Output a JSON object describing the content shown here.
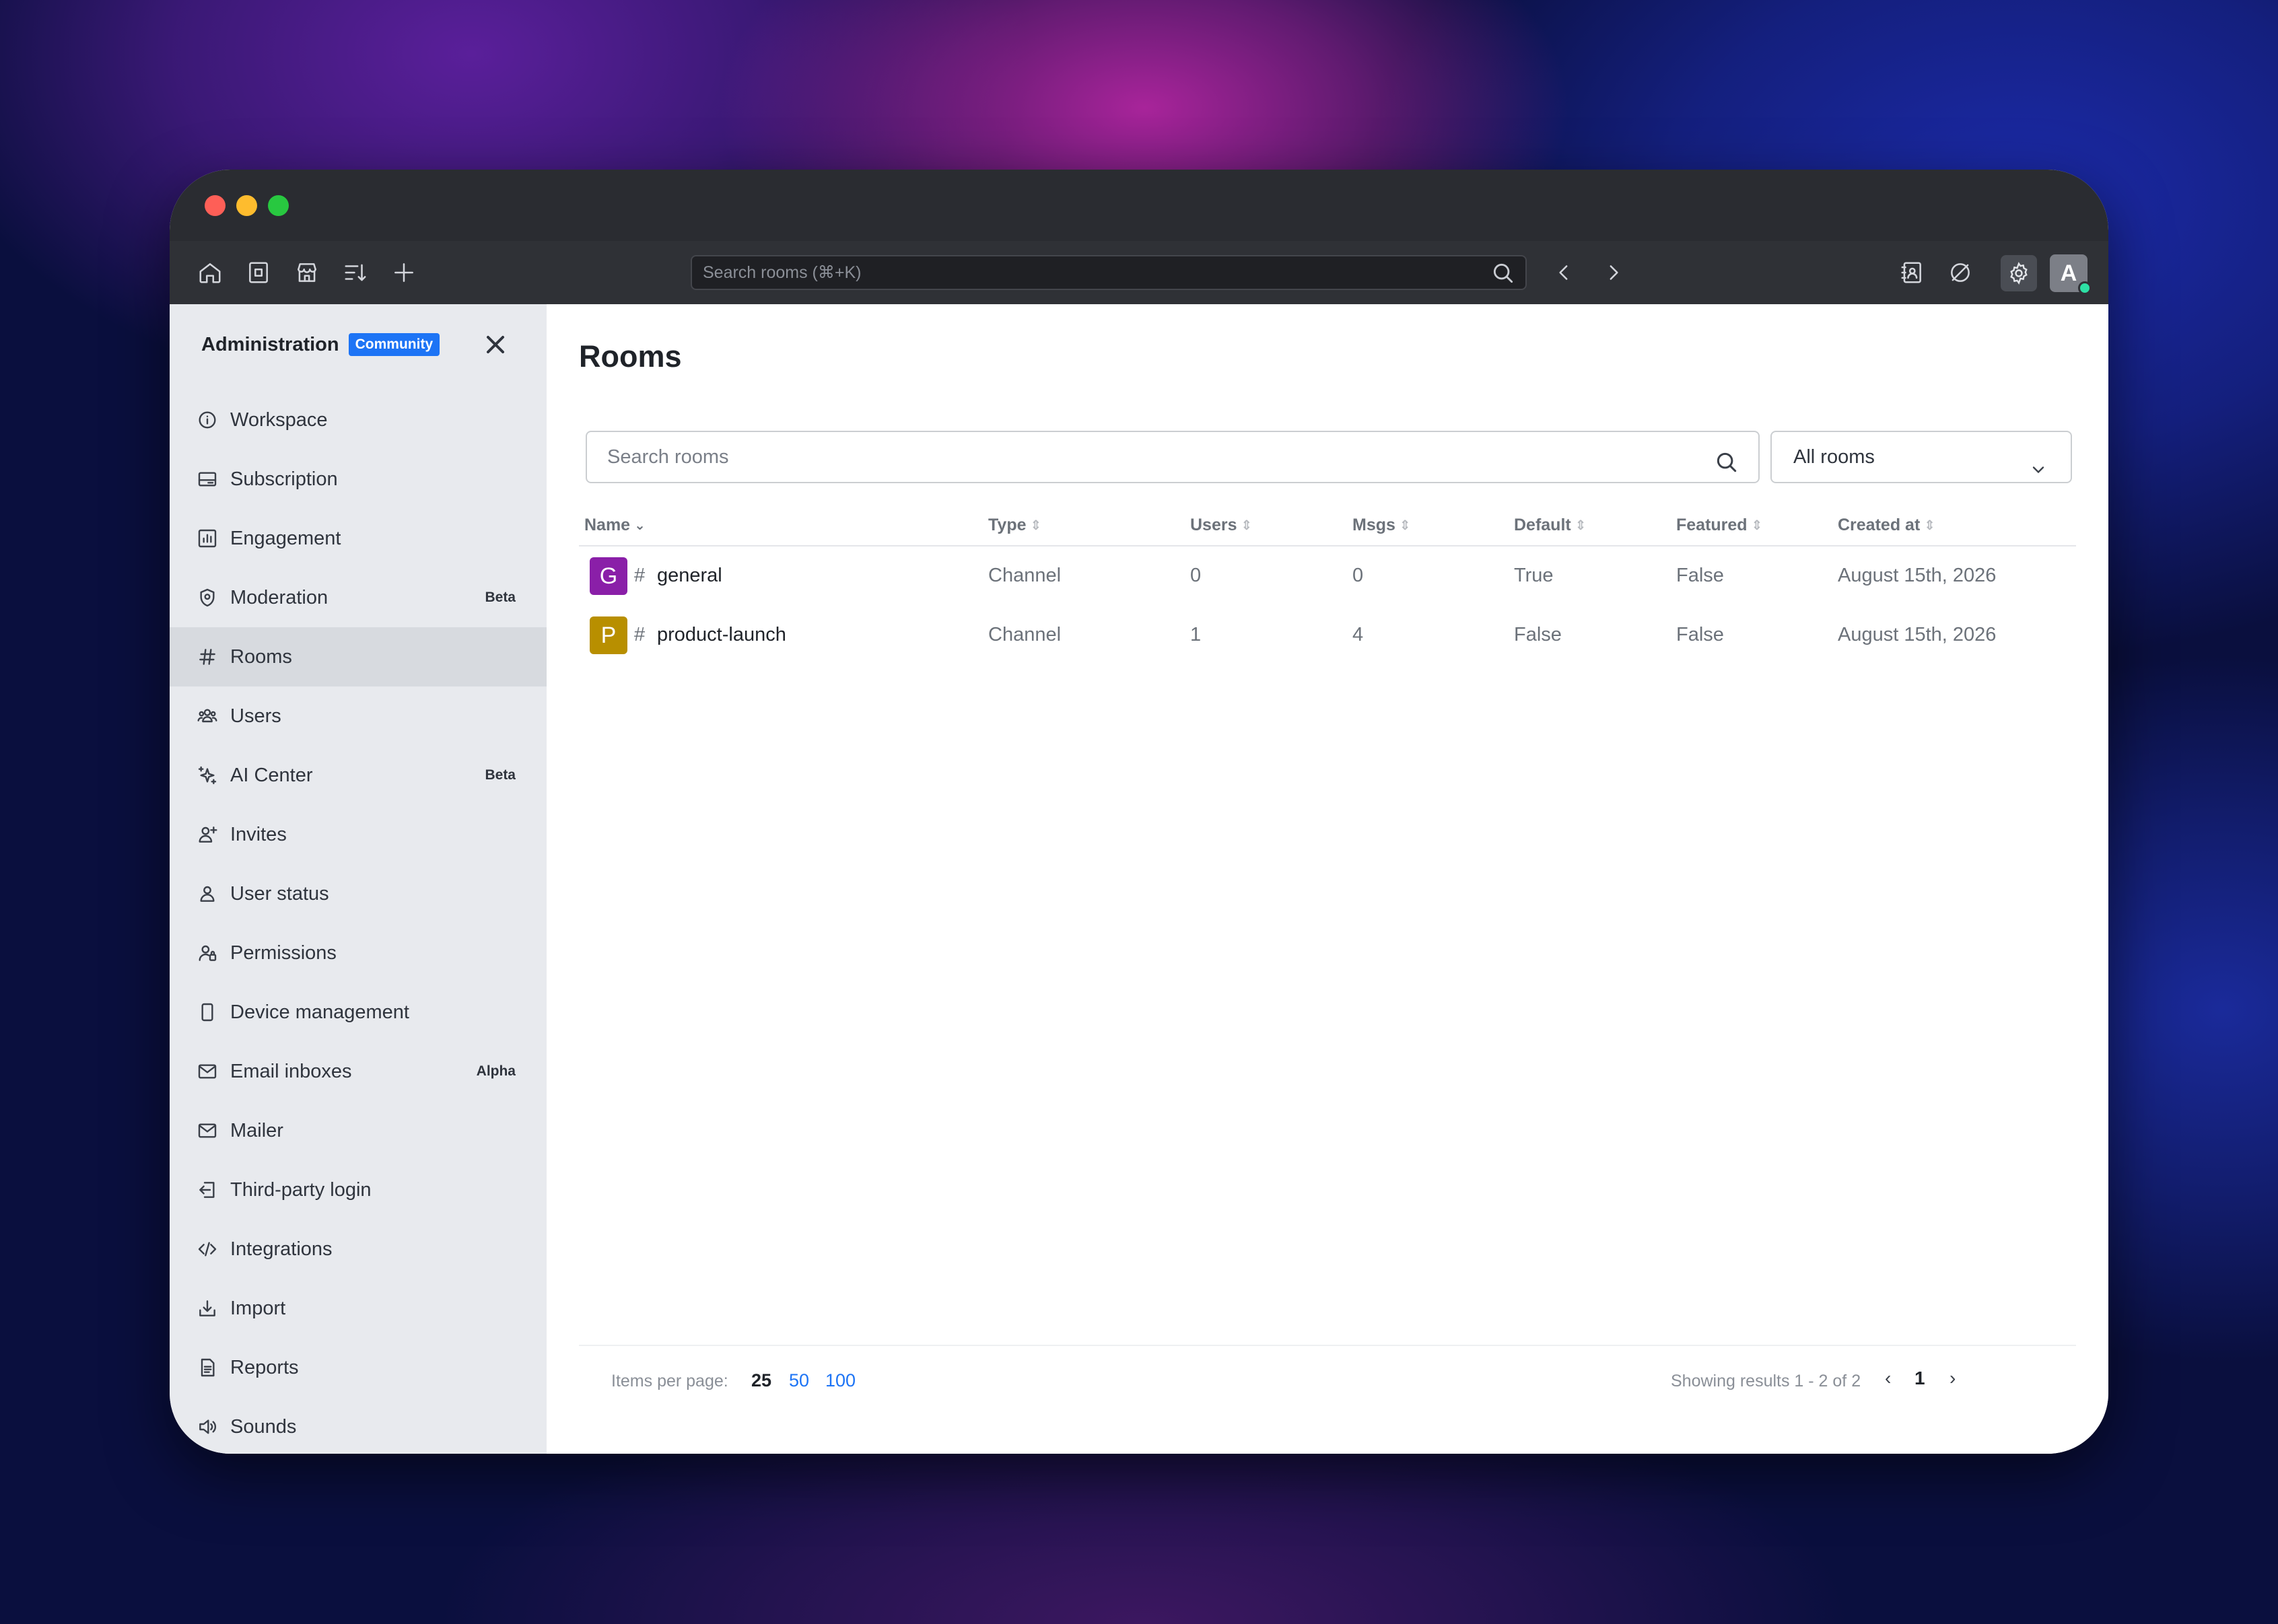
{
  "toolbar": {
    "search_placeholder": "Search rooms (⌘+K)",
    "avatar_initial": "A"
  },
  "sidebar": {
    "title": "Administration",
    "badge": "Community",
    "items": [
      {
        "label": "Workspace",
        "icon": "info-icon",
        "tag": ""
      },
      {
        "label": "Subscription",
        "icon": "card-icon",
        "tag": ""
      },
      {
        "label": "Engagement",
        "icon": "chart-icon",
        "tag": ""
      },
      {
        "label": "Moderation",
        "icon": "shield-icon",
        "tag": "Beta"
      },
      {
        "label": "Rooms",
        "icon": "hash-icon",
        "tag": "",
        "active": true
      },
      {
        "label": "Users",
        "icon": "team-icon",
        "tag": ""
      },
      {
        "label": "AI Center",
        "icon": "sparkles-icon",
        "tag": "Beta"
      },
      {
        "label": "Invites",
        "icon": "user-plus-icon",
        "tag": ""
      },
      {
        "label": "User status",
        "icon": "user-icon",
        "tag": ""
      },
      {
        "label": "Permissions",
        "icon": "user-lock-icon",
        "tag": ""
      },
      {
        "label": "Device management",
        "icon": "phone-icon",
        "tag": ""
      },
      {
        "label": "Email inboxes",
        "icon": "mail-icon",
        "tag": "Alpha"
      },
      {
        "label": "Mailer",
        "icon": "mail-icon",
        "tag": ""
      },
      {
        "label": "Third-party login",
        "icon": "login-icon",
        "tag": ""
      },
      {
        "label": "Integrations",
        "icon": "code-icon",
        "tag": ""
      },
      {
        "label": "Import",
        "icon": "import-icon",
        "tag": ""
      },
      {
        "label": "Reports",
        "icon": "file-icon",
        "tag": ""
      },
      {
        "label": "Sounds",
        "icon": "speaker-icon",
        "tag": ""
      }
    ]
  },
  "main": {
    "title": "Rooms",
    "search_placeholder": "Search rooms",
    "filter_value": "All rooms",
    "columns": [
      "Name",
      "Type",
      "Users",
      "Msgs",
      "Default",
      "Featured",
      "Created at"
    ],
    "rows": [
      {
        "initial": "G",
        "color": "#8a1fa8",
        "name": "general",
        "type": "Channel",
        "users": "0",
        "msgs": "0",
        "default": "True",
        "featured": "False",
        "created": "August 15th, 2026"
      },
      {
        "initial": "P",
        "color": "#b88f00",
        "name": "product-launch",
        "type": "Channel",
        "users": "1",
        "msgs": "4",
        "default": "False",
        "featured": "False",
        "created": "August 15th, 2026"
      }
    ],
    "footer": {
      "items_per_page_label": "Items per page:",
      "per_page_options": [
        "25",
        "50",
        "100"
      ],
      "showing": "Showing results 1 - 2 of 2",
      "current_page": "1"
    }
  }
}
